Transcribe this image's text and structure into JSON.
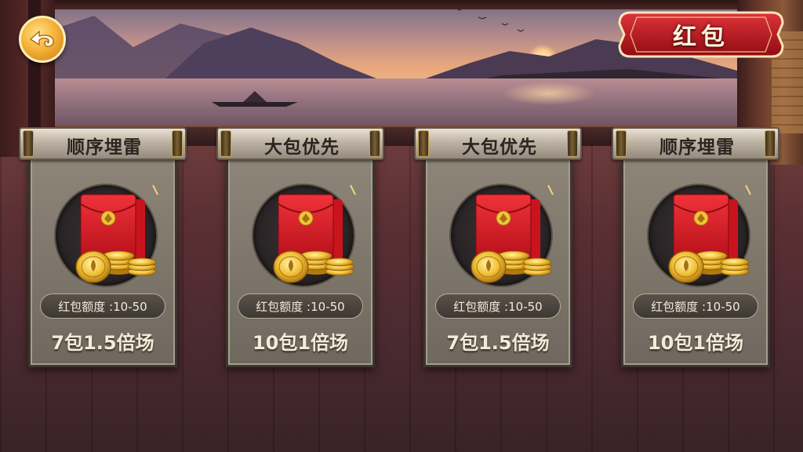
{
  "header": {
    "title": "红包",
    "back_icon": "cloud-arrow-back-icon"
  },
  "colors": {
    "plaque_red": "#b3131b",
    "gold": "#f5b43a",
    "card_panel": "#7e776b",
    "text_light": "#f4ead6",
    "scroll_text": "#2b2420"
  },
  "rooms": [
    {
      "name": "顺序埋雷",
      "quota": "红包额度 :10-50",
      "desc": "7包1.5倍场",
      "art_icon": "red-envelope-coins-icon"
    },
    {
      "name": "大包优先",
      "quota": "红包额度 :10-50",
      "desc": "10包1倍场",
      "art_icon": "red-envelope-coins-icon"
    },
    {
      "name": "大包优先",
      "quota": "红包额度 :10-50",
      "desc": "7包1.5倍场",
      "art_icon": "red-envelope-coins-icon"
    },
    {
      "name": "顺序埋雷",
      "quota": "红包额度 :10-50",
      "desc": "10包1倍场",
      "art_icon": "red-envelope-coins-icon"
    }
  ]
}
